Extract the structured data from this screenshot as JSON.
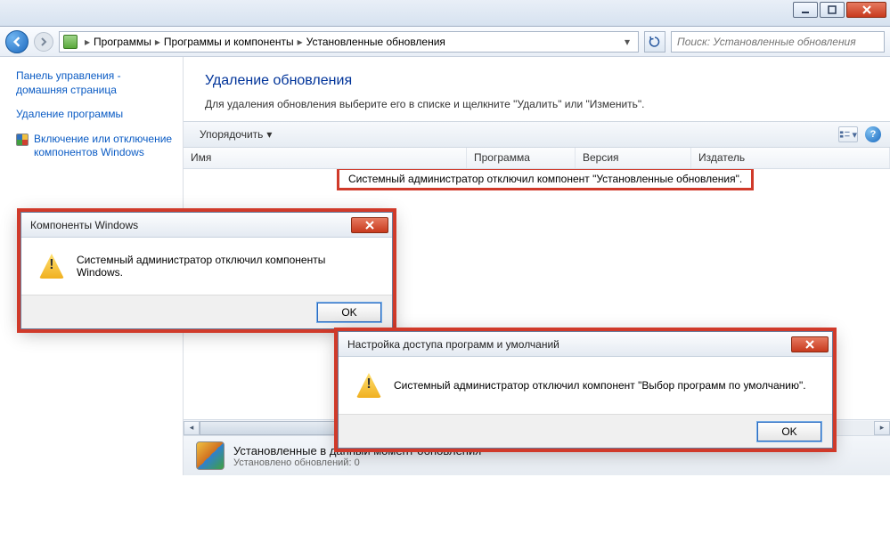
{
  "breadcrumb": {
    "items": [
      "Программы",
      "Программы и компоненты",
      "Установленные обновления"
    ]
  },
  "search": {
    "placeholder": "Поиск: Установленные обновления"
  },
  "sidebar": {
    "home": "Панель управления - домашняя страница",
    "uninstall": "Удаление программы",
    "features": "Включение или отключение компонентов Windows"
  },
  "content": {
    "title": "Удаление обновления",
    "subtitle": "Для удаления обновления выберите его в списке и щелкните \"Удалить\" или \"Изменить\"."
  },
  "toolbar": {
    "organize": "Упорядочить"
  },
  "columns": {
    "name": "Имя",
    "program": "Программа",
    "version": "Версия",
    "publisher": "Издатель"
  },
  "list_message": "Системный администратор отключил компонент \"Установленные обновления\".",
  "status": {
    "line1": "Установленные в данный момент обновления",
    "line2": "Установлено обновлений: 0"
  },
  "dialog1": {
    "title": "Компоненты Windows",
    "message": "Системный администратор отключил компоненты Windows.",
    "ok": "OK"
  },
  "dialog2": {
    "title": "Настройка доступа программ и умолчаний",
    "message": "Системный администратор отключил компонент \"Выбор программ по умолчанию\".",
    "ok": "OK"
  }
}
